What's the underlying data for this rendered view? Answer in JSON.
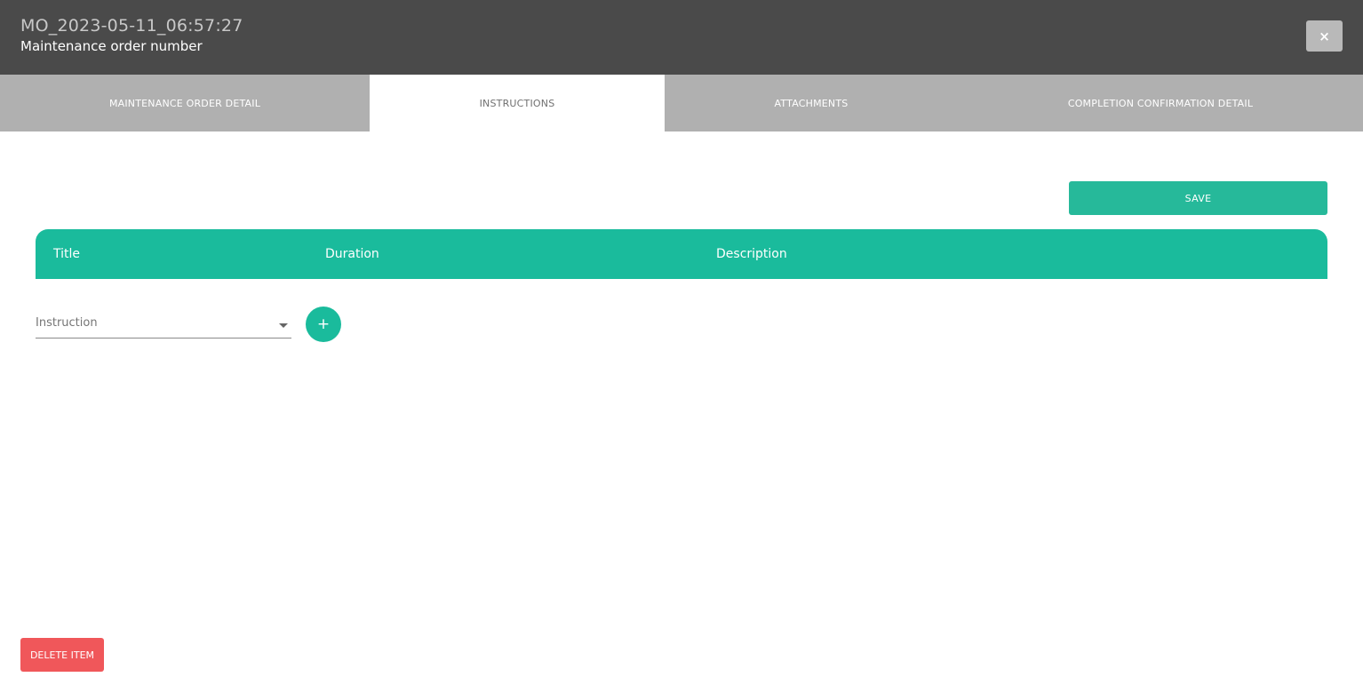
{
  "header": {
    "title": "MO_2023-05-11_06:57:27",
    "subtitle": "Maintenance order number",
    "close_label": "×"
  },
  "tabs": [
    {
      "label": "MAINTENANCE ORDER DETAIL",
      "active": false
    },
    {
      "label": "INSTRUCTIONS",
      "active": true
    },
    {
      "label": "ATTACHMENTS",
      "active": false
    },
    {
      "label": "COMPLETION CONFIRMATION DETAIL",
      "active": false
    }
  ],
  "toolbar": {
    "save_label": "SAVE"
  },
  "table": {
    "columns": [
      "Title",
      "Duration",
      "Description"
    ],
    "rows": []
  },
  "instruction_select": {
    "placeholder": "Instruction",
    "value": ""
  },
  "add_label": "+",
  "footer": {
    "delete_label": "DELETE ITEM"
  },
  "colors": {
    "header_bg": "#4a4a4a",
    "tab_bg": "#b0b0b0",
    "accent": "#1abb9c",
    "save_bg": "#26b99a",
    "danger": "#f0575a"
  }
}
